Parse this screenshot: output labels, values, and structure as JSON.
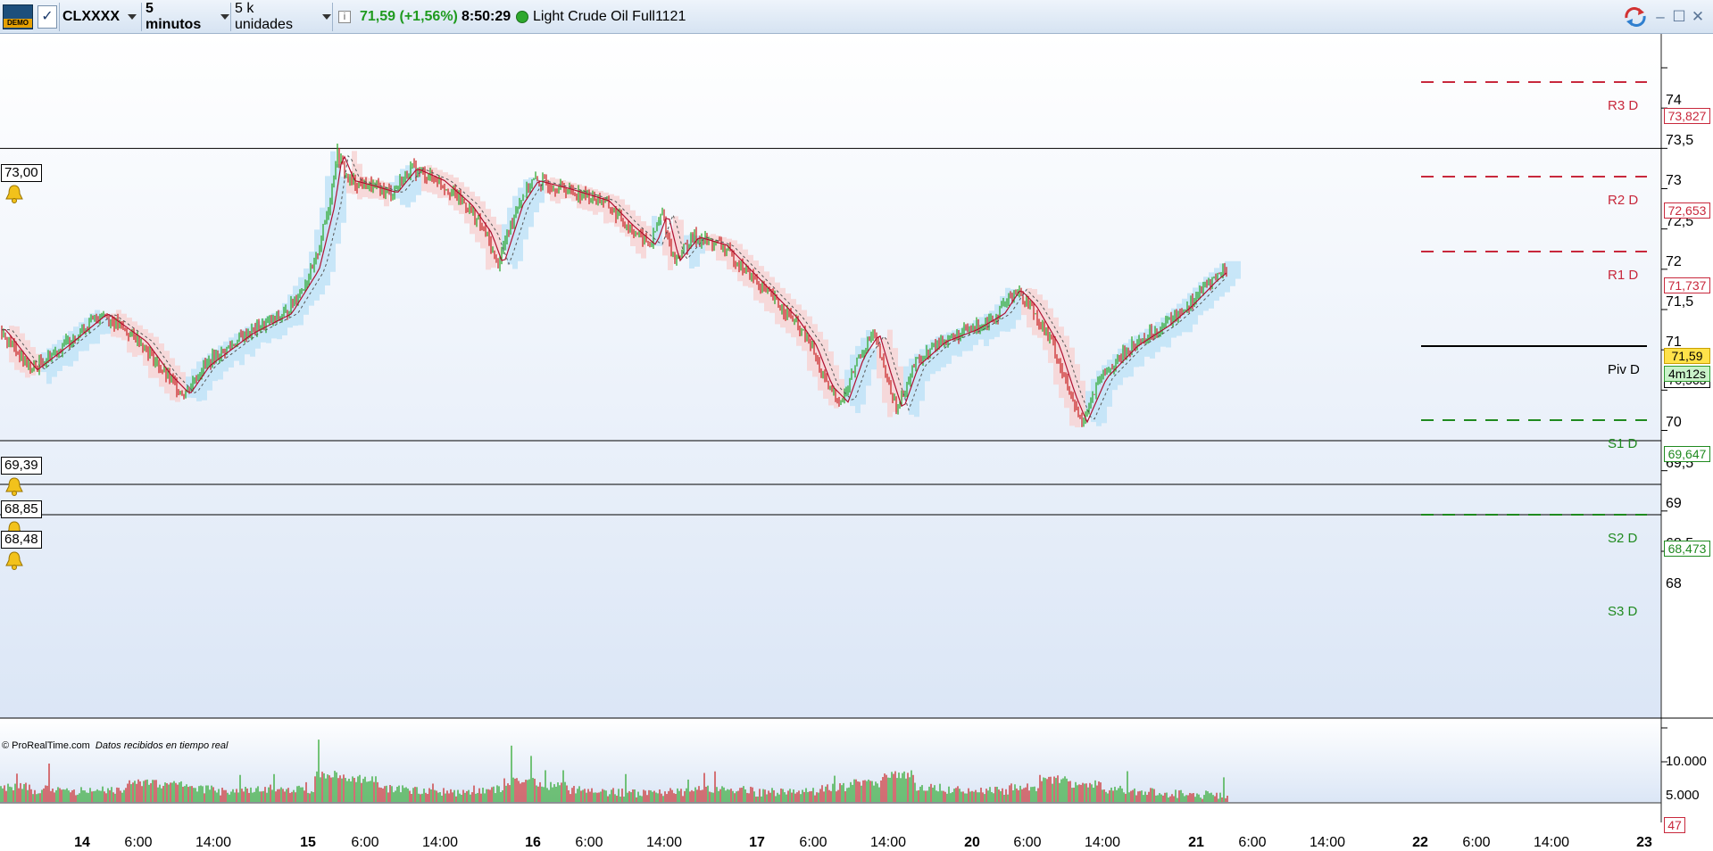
{
  "toolbar": {
    "demo_badge": "DEMO",
    "instrument": "CLXXXX",
    "timeframe": "5 minutos",
    "units": "5 k unidades",
    "last_price": "71,59",
    "change": "(+1,56%)",
    "time": "8:50:29",
    "instrument_name": "Light Crude Oil Full1121",
    "icons": [
      "demo-icon",
      "checkbox-icon",
      "info-icon",
      "live-status-icon",
      "sync-icon",
      "minimize-icon",
      "maximize-icon",
      "close-icon"
    ]
  },
  "price_axis": {
    "ticks": [
      "74",
      "73,5",
      "73",
      "72,5",
      "72",
      "71,5",
      "71",
      "70,5",
      "70",
      "69,5",
      "69",
      "68,5",
      "68"
    ],
    "current_price": "71,59",
    "countdown": "4m12s"
  },
  "pivots": [
    {
      "label": "R3 D",
      "value": "73,827",
      "color": "#c8283c"
    },
    {
      "label": "R2 D",
      "value": "72,653",
      "color": "#c8283c"
    },
    {
      "label": "R1 D",
      "value": "71,737",
      "color": "#c8283c"
    },
    {
      "label": "Piv D",
      "value": "70,563",
      "color": "#000000"
    },
    {
      "label": "S1 D",
      "value": "69,647",
      "color": "#1f8a1f"
    },
    {
      "label": "S2 D",
      "value": "68,473",
      "color": "#1f8a1f"
    },
    {
      "label": "S3 D",
      "value": "",
      "color": "#1f8a1f"
    }
  ],
  "alerts": [
    "73,00",
    "69,39",
    "68,85",
    "68,48"
  ],
  "volume_axis": {
    "ticks": [
      "10.000",
      "5.000"
    ],
    "current_volume": "47"
  },
  "x_axis": [
    {
      "label": "14",
      "bold": true
    },
    {
      "label": "6:00",
      "bold": false
    },
    {
      "label": "14:00",
      "bold": false
    },
    {
      "label": "15",
      "bold": true
    },
    {
      "label": "6:00",
      "bold": false
    },
    {
      "label": "14:00",
      "bold": false
    },
    {
      "label": "16",
      "bold": true
    },
    {
      "label": "6:00",
      "bold": false
    },
    {
      "label": "14:00",
      "bold": false
    },
    {
      "label": "17",
      "bold": true
    },
    {
      "label": "6:00",
      "bold": false
    },
    {
      "label": "14:00",
      "bold": false
    },
    {
      "label": "20",
      "bold": true
    },
    {
      "label": "6:00",
      "bold": false
    },
    {
      "label": "14:00",
      "bold": false
    },
    {
      "label": "21",
      "bold": true
    },
    {
      "label": "6:00",
      "bold": false
    },
    {
      "label": "14:00",
      "bold": false
    },
    {
      "label": "22",
      "bold": true
    },
    {
      "label": "6:00",
      "bold": false
    },
    {
      "label": "14:00",
      "bold": false
    },
    {
      "label": "23",
      "bold": true
    }
  ],
  "credit": {
    "source": "© ProRealTime.com",
    "note": "Datos recibidos en tiempo real"
  },
  "colors": {
    "up": "#22a322",
    "down": "#c81e1e",
    "cloud_bull": "#bfe3f7",
    "cloud_bear": "#f7d3d3",
    "highlight": "#ffe24a"
  },
  "chart_data": {
    "type": "candlestick",
    "price_path": [
      [
        0,
        70.75
      ],
      [
        0.8,
        70.25
      ],
      [
        1.6,
        70.55
      ],
      [
        2.6,
        70.95
      ],
      [
        3.6,
        70.6
      ],
      [
        4.2,
        70.2
      ],
      [
        4.7,
        69.95
      ],
      [
        5.2,
        70.3
      ],
      [
        6.3,
        70.7
      ],
      [
        7.3,
        70.95
      ],
      [
        8.0,
        71.5
      ],
      [
        8.4,
        72.3
      ],
      [
        8.6,
        72.95
      ],
      [
        8.9,
        72.6
      ],
      [
        9.3,
        72.55
      ],
      [
        10.0,
        72.45
      ],
      [
        10.5,
        72.75
      ],
      [
        11.2,
        72.6
      ],
      [
        11.9,
        72.3
      ],
      [
        12.4,
        71.95
      ],
      [
        12.7,
        71.55
      ],
      [
        13.2,
        72.3
      ],
      [
        13.6,
        72.6
      ],
      [
        14.4,
        72.5
      ],
      [
        15.4,
        72.35
      ],
      [
        16.0,
        72.05
      ],
      [
        16.6,
        71.8
      ],
      [
        16.9,
        72.2
      ],
      [
        17.2,
        71.6
      ],
      [
        17.7,
        71.9
      ],
      [
        18.4,
        71.8
      ],
      [
        19.4,
        71.3
      ],
      [
        20.2,
        70.9
      ],
      [
        20.7,
        70.55
      ],
      [
        21.1,
        70.05
      ],
      [
        21.5,
        69.85
      ],
      [
        21.9,
        70.4
      ],
      [
        22.3,
        70.7
      ],
      [
        22.6,
        70.2
      ],
      [
        22.9,
        69.75
      ],
      [
        23.3,
        70.3
      ],
      [
        24.0,
        70.6
      ],
      [
        24.8,
        70.75
      ],
      [
        25.5,
        70.95
      ],
      [
        25.9,
        71.25
      ],
      [
        26.3,
        71.05
      ],
      [
        26.9,
        70.55
      ],
      [
        27.3,
        69.95
      ],
      [
        27.6,
        69.6
      ],
      [
        28.1,
        70.15
      ],
      [
        28.9,
        70.55
      ],
      [
        29.7,
        70.8
      ],
      [
        30.3,
        71.05
      ],
      [
        30.9,
        71.35
      ],
      [
        31.4,
        71.55
      ]
    ],
    "volume_peaks": [
      0.4,
      0.3,
      0.25,
      0.3,
      0.6,
      0.5,
      0.3,
      0.25,
      0.35,
      0.3,
      0.9,
      0.7,
      0.35,
      0.25,
      0.2,
      0.3,
      0.6,
      0.45,
      0.3,
      0.2,
      0.15,
      0.2,
      0.3,
      0.25,
      0.2,
      0.25,
      0.4,
      0.55,
      0.9,
      0.4,
      0.3,
      0.25,
      0.4,
      0.7,
      0.5,
      0.3,
      0.2,
      0.15,
      0.1
    ]
  }
}
